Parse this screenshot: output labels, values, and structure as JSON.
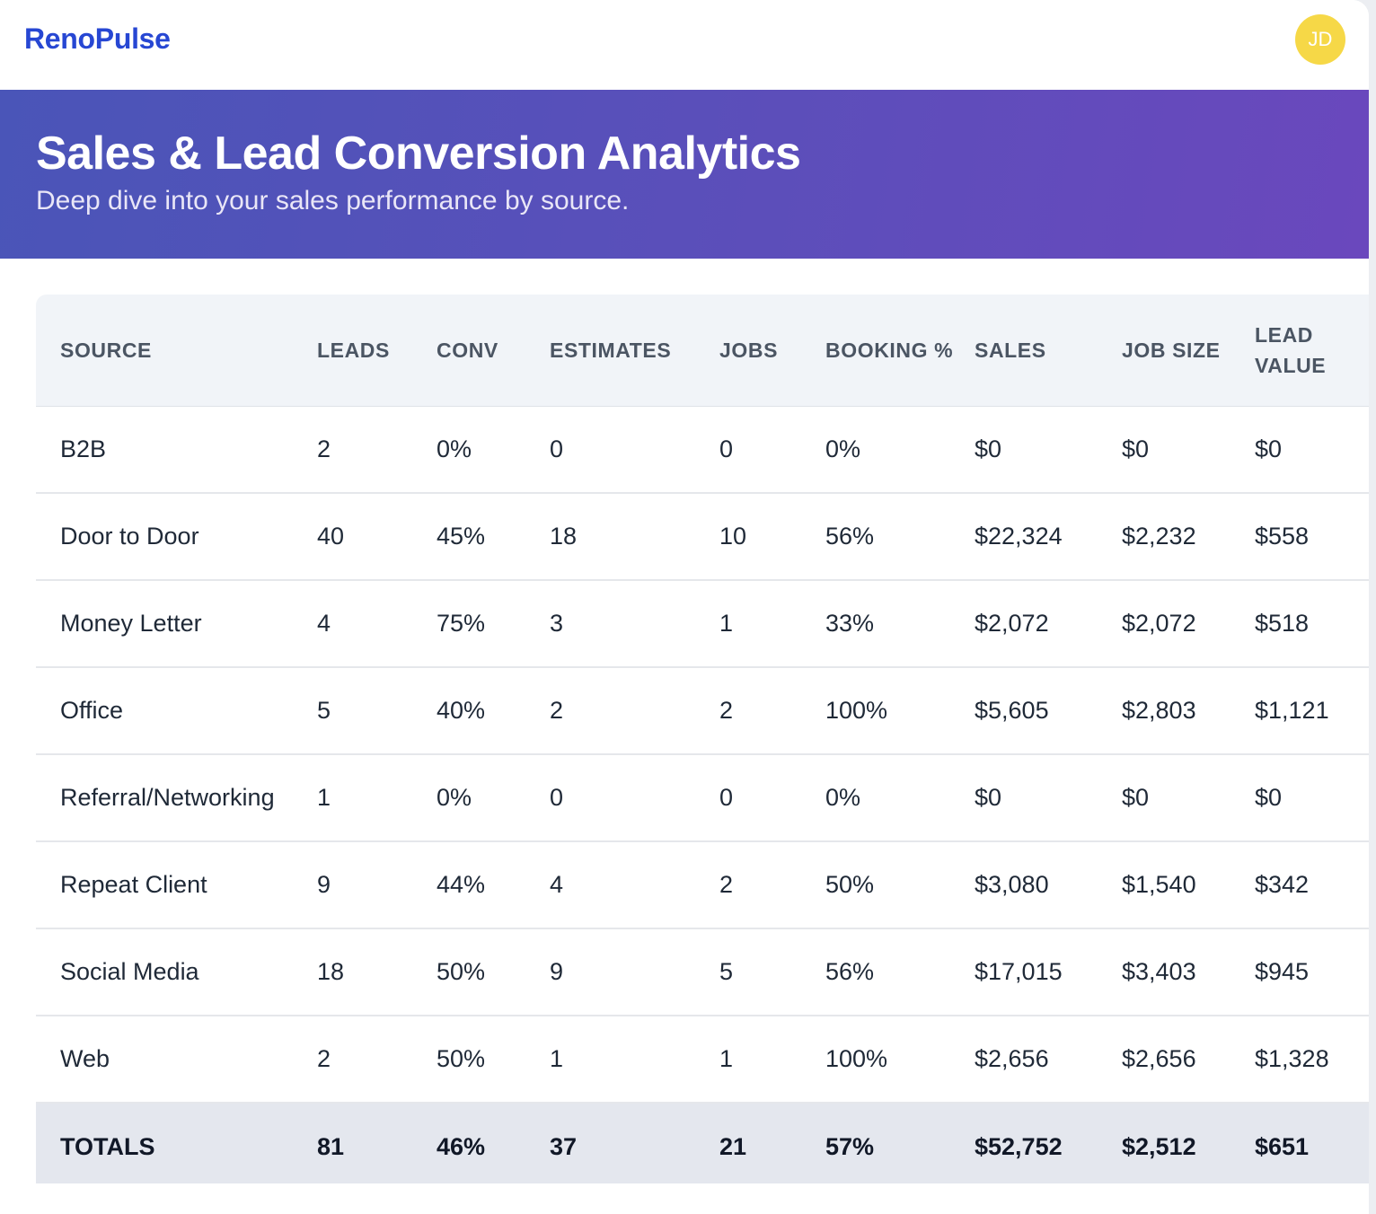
{
  "app": {
    "brand": "RenoPulse",
    "avatar_initials": "JD"
  },
  "hero": {
    "title": "Sales & Lead Conversion Analytics",
    "subtitle": "Deep dive into your sales performance by source."
  },
  "table": {
    "headers": {
      "source": "SOURCE",
      "leads": "LEADS",
      "conv": "CONV",
      "estimates": "ESTIMATES",
      "jobs": "JOBS",
      "booking": "BOOKING %",
      "sales": "SALES",
      "job_size": "JOB SIZE",
      "lead_value": "LEAD VALUE"
    },
    "rows": [
      [
        "B2B",
        "2",
        "0%",
        "0",
        "0",
        "0%",
        "$0",
        "$0",
        "$0"
      ],
      [
        "Door to Door",
        "40",
        "45%",
        "18",
        "10",
        "56%",
        "$22,324",
        "$2,232",
        "$558"
      ],
      [
        "Money Letter",
        "4",
        "75%",
        "3",
        "1",
        "33%",
        "$2,072",
        "$2,072",
        "$518"
      ],
      [
        "Office",
        "5",
        "40%",
        "2",
        "2",
        "100%",
        "$5,605",
        "$2,803",
        "$1,121"
      ],
      [
        "Referral/Networking",
        "1",
        "0%",
        "0",
        "0",
        "0%",
        "$0",
        "$0",
        "$0"
      ],
      [
        "Repeat Client",
        "9",
        "44%",
        "4",
        "2",
        "50%",
        "$3,080",
        "$1,540",
        "$342"
      ],
      [
        "Social Media",
        "18",
        "50%",
        "9",
        "5",
        "56%",
        "$17,015",
        "$3,403",
        "$945"
      ],
      [
        "Web",
        "2",
        "50%",
        "1",
        "1",
        "100%",
        "$2,656",
        "$2,656",
        "$1,328"
      ]
    ],
    "totals": [
      "TOTALS",
      "81",
      "46%",
      "37",
      "21",
      "57%",
      "$52,752",
      "$2,512",
      "$651"
    ]
  },
  "colors": {
    "brand": "#2747d3",
    "avatar": "#f6d847",
    "hero_gradient_start": "#4a55b8",
    "hero_gradient_end": "#6a48bd",
    "header_bg": "#f1f4f8",
    "totals_bg": "#e4e7ee"
  }
}
